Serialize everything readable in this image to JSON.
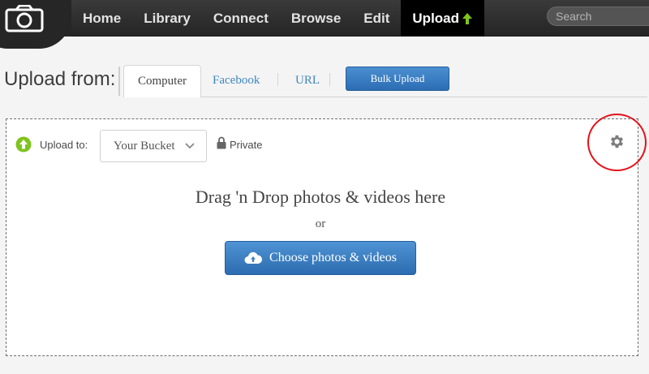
{
  "nav": {
    "items": [
      {
        "label": "Home",
        "active": false
      },
      {
        "label": "Library",
        "active": false
      },
      {
        "label": "Connect",
        "active": false
      },
      {
        "label": "Browse",
        "active": false
      },
      {
        "label": "Edit",
        "active": false
      },
      {
        "label": "Upload",
        "active": true
      }
    ],
    "search_placeholder": "Search",
    "logo_icon": "camera-icon",
    "active_arrow_icon": "arrow-up-icon"
  },
  "upload_from": {
    "label": "Upload from:",
    "tabs": [
      {
        "label": "Computer",
        "selected": true
      },
      {
        "label": "Facebook",
        "selected": false
      },
      {
        "label": "URL",
        "selected": false
      }
    ],
    "bulk_upload_label": "Bulk Upload"
  },
  "drop_zone": {
    "upload_to_label": "Upload to:",
    "bucket_value": "Your Bucket",
    "privacy_label": "Private",
    "drag_title": "Drag 'n Drop photos & videos here",
    "or_text": "or",
    "choose_label": "Choose photos & videos",
    "settings_icon": "gear-icon"
  },
  "colors": {
    "accent_blue": "#2c6db3",
    "link_blue": "#3f86c2",
    "upload_green": "#7fc41b",
    "annotation_red": "#e3111b",
    "nav_bg": "#2b2b2b"
  }
}
